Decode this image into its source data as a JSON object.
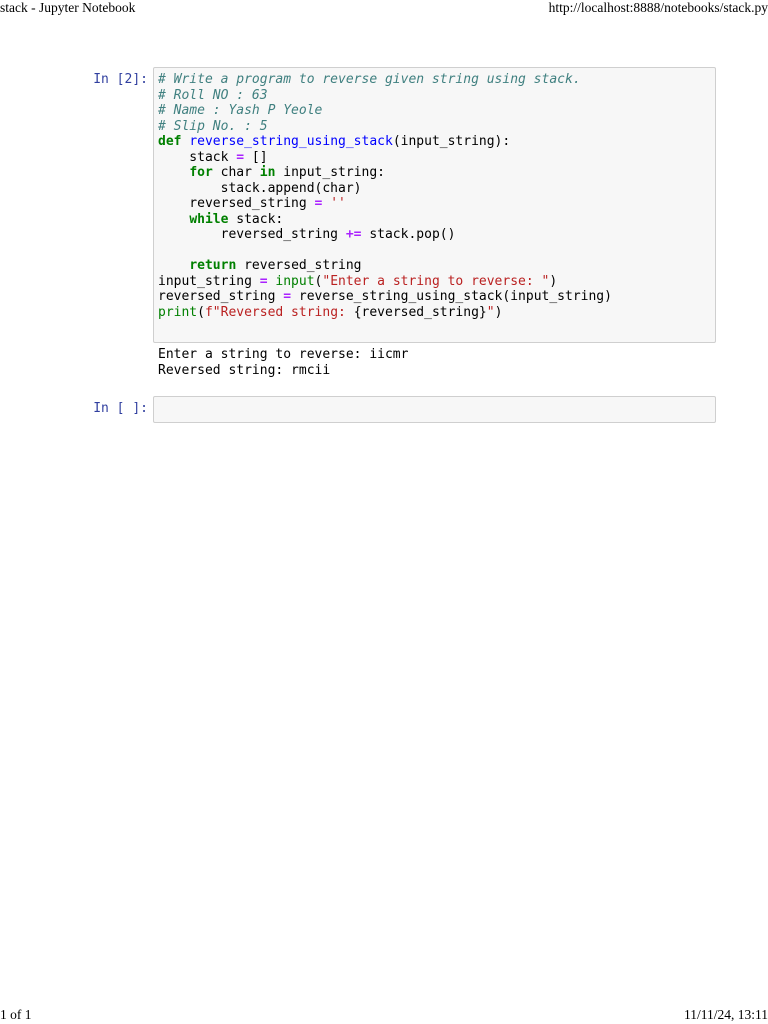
{
  "print_header": {
    "title": "stack - Jupyter Notebook",
    "url": "http://localhost:8888/notebooks/stack.py"
  },
  "print_footer": {
    "page": "1 of 1",
    "datetime": "11/11/24, 13:11"
  },
  "cells": [
    {
      "prompt": "In [2]:",
      "code_lines": [
        "# Write a program to reverse given string using stack.",
        "# Roll NO : 63",
        "# Name : Yash P Yeole",
        "# Slip No. : 5",
        "def reverse_string_using_stack(input_string):",
        "    stack = []",
        "    for char in input_string:",
        "        stack.append(char)",
        "    reversed_string = ''",
        "    while stack:",
        "        reversed_string += stack.pop()",
        "",
        "    return reversed_string",
        "input_string = input(\"Enter a string to reverse: \")",
        "reversed_string = reverse_string_using_stack(input_string)",
        "print(f\"Reversed string: {reversed_string}\")"
      ],
      "output_lines": [
        "Enter a string to reverse: iicmr",
        "Reversed string: rmcii"
      ]
    },
    {
      "prompt": "In [ ]:",
      "code_lines": [],
      "output_lines": []
    }
  ]
}
